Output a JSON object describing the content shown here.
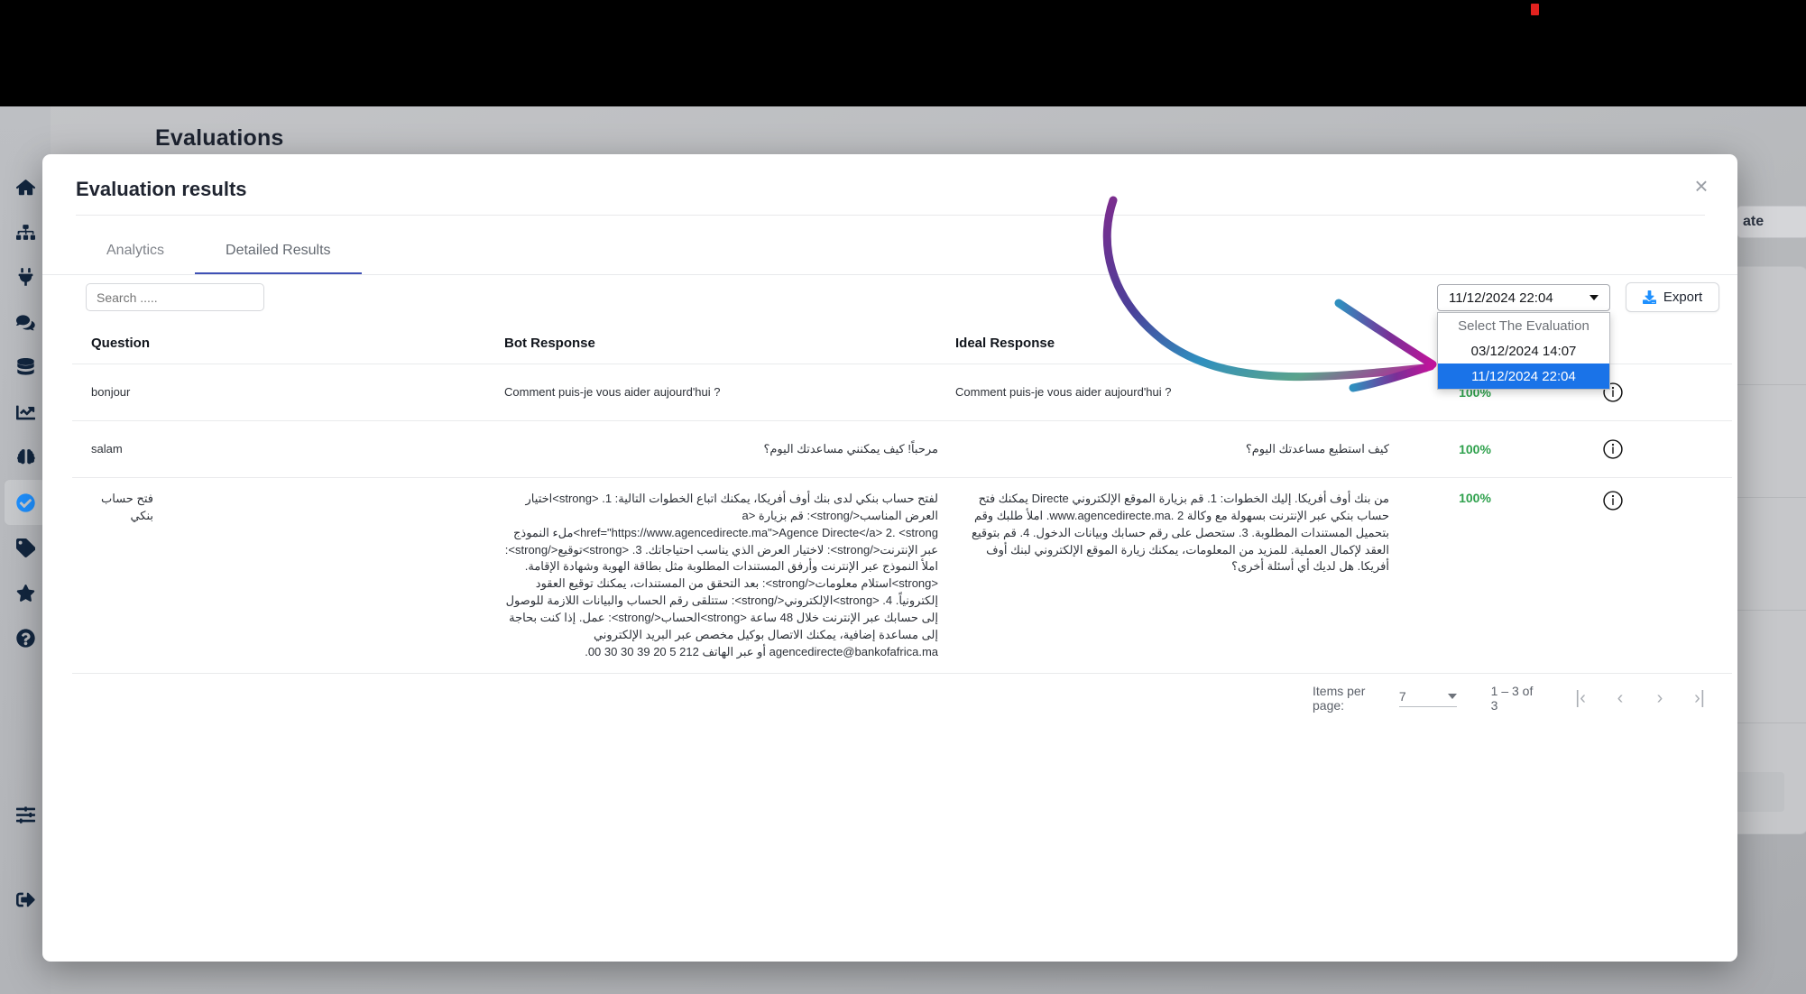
{
  "app": {
    "page_title": "Evaluations"
  },
  "sidebar": {
    "items": [
      {
        "icon": "home-icon",
        "name": "home"
      },
      {
        "icon": "sitemap-icon",
        "name": "sitemap"
      },
      {
        "icon": "plug-icon",
        "name": "integrations"
      },
      {
        "icon": "chat-icon",
        "name": "conversations"
      },
      {
        "icon": "database-icon",
        "name": "database"
      },
      {
        "icon": "chart-line-icon",
        "name": "analytics"
      },
      {
        "icon": "brain-icon",
        "name": "models"
      },
      {
        "icon": "check-circle-icon",
        "name": "evaluations",
        "active": true
      },
      {
        "icon": "tag-icon",
        "name": "tags"
      },
      {
        "icon": "star-icon",
        "name": "favorites"
      },
      {
        "icon": "question-circle-icon",
        "name": "help"
      }
    ],
    "bottom_items": [
      {
        "icon": "sliders-icon",
        "name": "settings"
      },
      {
        "icon": "logout-icon",
        "name": "logout"
      }
    ]
  },
  "background": {
    "button_label": "ate"
  },
  "modal": {
    "title": "Evaluation results",
    "close_label": "×",
    "tabs": [
      {
        "label": "Analytics",
        "active": false
      },
      {
        "label": "Detailed Results",
        "active": true
      }
    ],
    "search": {
      "placeholder": "Search .....",
      "value": ""
    },
    "evaluation_select": {
      "selected": "11/12/2024 22:04",
      "open": true,
      "options": [
        {
          "label": "Select The Evaluation",
          "kind": "placeholder"
        },
        {
          "label": "03/12/2024 14:07",
          "kind": "option"
        },
        {
          "label": "11/12/2024 22:04",
          "kind": "selected"
        }
      ]
    },
    "export_button": {
      "label": "Export",
      "icon": "download-icon"
    },
    "table": {
      "columns": [
        "Question",
        "Bot Response",
        "Ideal Response",
        "",
        ""
      ],
      "rows": [
        {
          "question": "bonjour",
          "bot_response": "Comment puis-je vous aider aujourd'hui ?",
          "bot_rtl": false,
          "ideal_response": "Comment puis-je vous aider aujourd'hui ?",
          "ideal_rtl": false,
          "score": "100%",
          "action_icon": "info-circle-icon"
        },
        {
          "question": "salam",
          "bot_response": "مرحباً! كيف يمكنني مساعدتك اليوم؟",
          "bot_rtl": true,
          "ideal_response": "كيف استطيع مساعدتك اليوم؟",
          "ideal_rtl": true,
          "score": "100%",
          "action_icon": "info-circle-icon"
        },
        {
          "question": "فتح حساب بنكي",
          "bot_response": "لفتح حساب بنكي لدى بنك أوف أفريكا، يمكنك اتباع الخطوات التالية: 1. <strong>اختيار العرض المناسب</strong>: قم بزيارة <a href=\"https://www.agencedirecte.ma\">Agence Directe</a> 2. <strong>ملء النموذج عبر الإنترنت</strong>: لاختيار العرض الذي يناسب احتياجاتك. 3. <strong>توقيع</strong>: املأ النموذج عبر الإنترنت وأرفق المستندات المطلوبة مثل بطاقة الهوية وشهادة الإقامة. <strong>استلام معلومات</strong>: بعد التحقق من المستندات، يمكنك توقيع العقود إلكترونياً. 4. <strong>الإلكتروني</strong>: ستتلقى رقم الحساب والبيانات اللازمة للوصول إلى حسابك عبر الإنترنت خلال 48 ساعة <strong>الحساب</strong>: عمل. إذا كنت بحاجة إلى مساعدة إضافية، يمكنك الاتصال بوكيل مخصص عبر البريد الإلكتروني agencedirecte@bankofafrica.ma أو عبر الهاتف 212 5 20 39 30 30 00.",
          "bot_rtl": true,
          "ideal_response": "من بنك أوف أفريكا. إليك الخطوات: 1. قم بزيارة الموقع الإلكتروني Directe يمكنك فتح حساب بنكي عبر الإنترنت بسهولة مع وكالة www.agencedirecte.ma. 2. املأ طلبك وقم بتحميل المستندات المطلوبة. 3. ستحصل على رقم حسابك وبيانات الدخول. 4. قم بتوقيع العقد لإكمال العملية. للمزيد من المعلومات، يمكنك زيارة الموقع الإلكتروني لبنك أوف أفريكا. هل لديك أي أسئلة أخرى؟",
          "ideal_rtl": true,
          "score": "100%",
          "action_icon": "info-circle-icon"
        }
      ]
    },
    "paginator": {
      "items_per_page_label": "Items per page:",
      "items_per_page_value": "7",
      "range_label": "1 – 3 of 3",
      "first_label": "|‹",
      "prev_label": "‹",
      "next_label": "›",
      "last_label": "›|"
    }
  },
  "colors": {
    "accent": "#3f51b5",
    "selected_option": "#1a73e8",
    "score_green": "#2fa14d",
    "export_icon": "#1e90ff",
    "annotation_arrow_start": "#7b2d8e",
    "annotation_arrow_mid": "#2f8fbf",
    "annotation_arrow_end": "#c0149a"
  }
}
